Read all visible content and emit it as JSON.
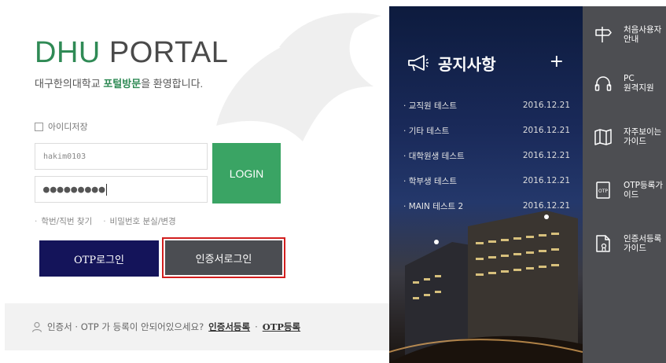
{
  "brand": {
    "dhu": "DHU",
    "portal": " PORTAL"
  },
  "welcome": {
    "prefix": "대구한의대학교 ",
    "highlight": "포털방문",
    "suffix": "을 환영합니다."
  },
  "login_form": {
    "remember_label": "아이디저장",
    "id_value": "hakim0103",
    "password_masked": "●●●●●●●●●",
    "login_label": "LOGIN",
    "find_id": "학번/직번 찾기",
    "find_pw": "비밀번호 분실/변경",
    "otp_login": "OTP로그인",
    "cert_login": "인증서로그인"
  },
  "cert_notice": {
    "text": "인증서 · OTP 가 등록이 안되어있으세요?",
    "cert_register": "인증서등록",
    "separator": "·",
    "otp_register": "OTP등록"
  },
  "notices": {
    "title": "공지사항",
    "more": "+",
    "items": [
      {
        "title": "교직원 테스트",
        "date": "2016.12.21"
      },
      {
        "title": "기타 테스트",
        "date": "2016.12.21"
      },
      {
        "title": "대학원생 테스트",
        "date": "2016.12.21"
      },
      {
        "title": "학부생 테스트",
        "date": "2016.12.21"
      },
      {
        "title": "MAIN 테스트 2",
        "date": "2016.12.21"
      }
    ]
  },
  "quick_menu": [
    {
      "icon": "signpost-icon",
      "line1": "처음사용자",
      "line2": "안내"
    },
    {
      "icon": "headset-icon",
      "line1": "PC",
      "line2": "원격지원"
    },
    {
      "icon": "book-icon",
      "line1": "자주보이는",
      "line2": "가이드"
    },
    {
      "icon": "otp-device-icon",
      "line1": "OTP등록가",
      "line2": "이드"
    },
    {
      "icon": "certificate-doc-icon",
      "line1": "인증서등록",
      "line2": "가이드"
    }
  ],
  "colors": {
    "brand_green": "#2f8a55",
    "login_button": "#3aa464",
    "otp_button": "#14145a",
    "cert_button": "#4b4d52",
    "highlight_border": "#d21e1e",
    "quick_menu_bg": "#4d4e52"
  }
}
